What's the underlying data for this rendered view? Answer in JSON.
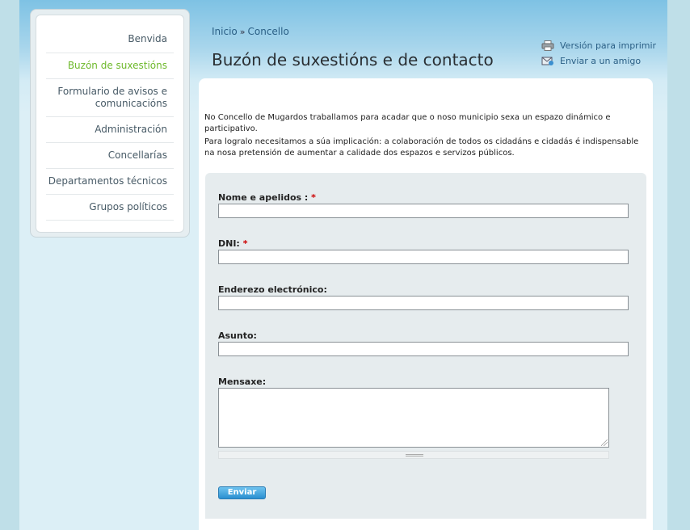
{
  "sidebar": {
    "items": [
      {
        "label": "Benvida"
      },
      {
        "label": "Buzón de suxestións"
      },
      {
        "label": "Formulario de avisos e comunicacións"
      },
      {
        "label": "Administración"
      },
      {
        "label": "Concellarías"
      },
      {
        "label": "Departamentos técnicos"
      },
      {
        "label": "Grupos políticos"
      }
    ],
    "active_color": "#6eb92b"
  },
  "breadcrumb": {
    "home": "Inicio",
    "separator": "»",
    "current": "Concello"
  },
  "page_title": "Buzón de suxestións e de contacto",
  "tools": {
    "print_label": "Versión para imprimir",
    "email_label": "Enviar a un amigo"
  },
  "intro": {
    "p1": "No Concello de Mugardos traballamos para acadar que o noso municipio sexa un espazo dinámico e participativo.",
    "p2": "Para logralo necesitamos a súa implicación: a colaboración de todos os cidadáns e cidadás é indispensable na nosa pretensión de aumentar a calidade dos espazos e servizos públicos."
  },
  "form": {
    "name_label": "Nome e apelidos :",
    "dni_label": "DNI:",
    "required_mark": "*",
    "email_label": "Enderezo electrónico:",
    "subject_label": "Asunto:",
    "message_label": "Mensaxe:",
    "submit_label": "Enviar",
    "name_value": "",
    "dni_value": "",
    "email_value": "",
    "subject_value": "",
    "message_value": ""
  }
}
